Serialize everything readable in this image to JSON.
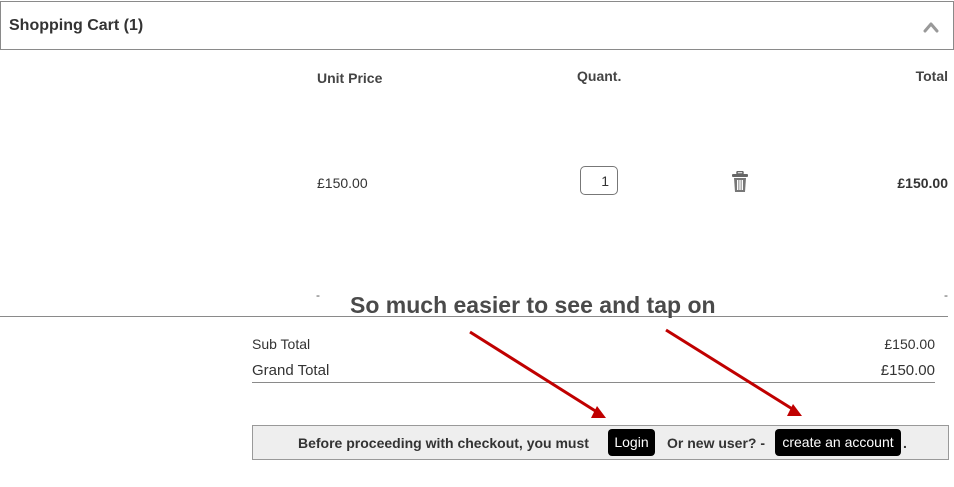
{
  "header": {
    "title": "Shopping Cart (1)",
    "collapse_icon": "chevron-up-icon"
  },
  "columns": {
    "unit_price": "Unit Price",
    "quantity": "Quant.",
    "total": "Total"
  },
  "item": {
    "unit_price": "£150.00",
    "quantity": "1",
    "total": "£150.00",
    "delete_icon": "trash-icon",
    "left_dash": "-",
    "right_dash": "-"
  },
  "annotation": {
    "text": "So much easier to see and tap on",
    "arrow_color": "#c00000"
  },
  "totals": {
    "sub_total_label": "Sub Total",
    "sub_total_value": "£150.00",
    "grand_total_label": "Grand Total",
    "grand_total_value": "£150.00"
  },
  "checkout_notice": {
    "before_text": "Before proceeding with checkout, you must",
    "login_label": "Login",
    "or_text": "Or new user? -",
    "create_account_label": "create an account",
    "trailing": "."
  }
}
